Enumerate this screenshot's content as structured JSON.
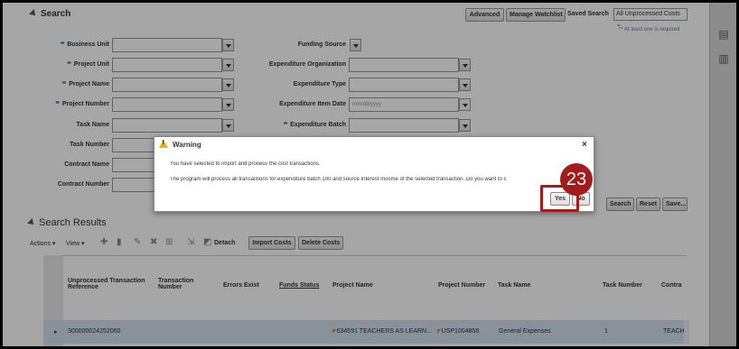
{
  "search": {
    "title": "Search",
    "advanced_label": "Advanced",
    "manage_watchlist_label": "Manage Watchlist",
    "saved_search_label": "Saved Search",
    "saved_search_value": "All Unprocessed Costs",
    "required_note": "** At least one is required",
    "required_marker": "**",
    "fields": {
      "business_unit": "Business Unit",
      "project_unit": "Project Unit",
      "project_name": "Project Name",
      "project_number": "Project Number",
      "task_name": "Task Name",
      "task_number": "Task Number",
      "contract_name": "Contract Name",
      "contract_number": "Contract Number",
      "funding_source": "Funding Source",
      "expenditure_organization": "Expenditure Organization",
      "expenditure_type": "Expenditure Type",
      "expenditure_item_date": "Expenditure Item Date",
      "expenditure_item_date_placeholder": "mm/dd/yyyy",
      "expenditure_batch": "Expenditure Batch"
    },
    "search_button": "Search",
    "reset_button": "Reset",
    "save_button": "Save..."
  },
  "results": {
    "title": "Search Results",
    "actions_menu": "Actions",
    "view_menu": "View",
    "detach_label": "Detach",
    "import_costs_label": "Import Costs",
    "delete_costs_label": "Delete Costs",
    "columns": {
      "unprocessed_ref": "Unprocessed Transaction Reference",
      "transaction_number": "Transaction Number",
      "errors_exist": "Errors Exist",
      "funds_status": "Funds Status",
      "project_name": "Project Name",
      "project_number": "Project Number",
      "task_name": "Task Name",
      "task_number": "Task Number",
      "contract": "Contra"
    },
    "rows": [
      {
        "unprocessed_ref": "300000024252060",
        "project_name": "634591 TEACHERS AS LEARN...",
        "project_number": "USP1004858",
        "task_name": "General Expenses",
        "task_number": "1",
        "contract": "TEACH"
      }
    ]
  },
  "dialog": {
    "title": "Warning",
    "close_glyph": "×",
    "message_1": "You have selected to import and process the cost transactions.",
    "message_2": "The program will process all transactions for expenditure batch 100 and source Interest Income of the selected transaction. Do you want to c",
    "yes_label": "Yes",
    "no_label": "No"
  },
  "step": {
    "number": "23"
  },
  "colors": {
    "highlight": "#a31b1b",
    "required": "#1a5fb4",
    "selected_row": "#cfe0ef"
  }
}
